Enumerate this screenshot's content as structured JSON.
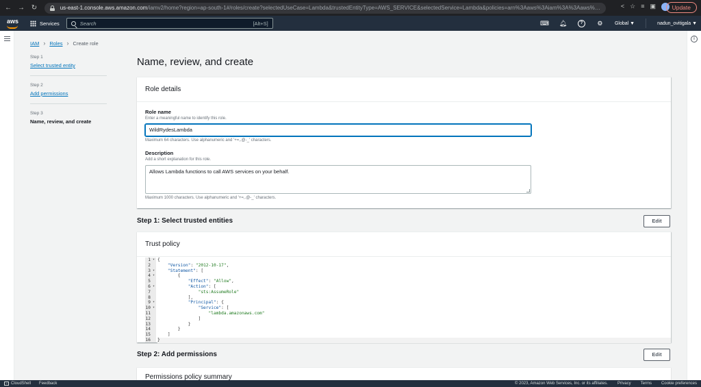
{
  "browser": {
    "url_host": "us-east-1.console.aws.amazon.com",
    "url_path": "/iamv2/home?region=ap-south-1#/roles/create?selectedUseCase=Lambda&trustedEntityType=AWS_SERVICE&selectedService=Lambda&policies=arn%3Aaws%3Aiam%3A%3Aaws%3Apolicy...",
    "update_label": "Update"
  },
  "aws_nav": {
    "logo": "aws",
    "services_label": "Services",
    "search_placeholder": "Search",
    "search_shortcut": "[Alt+S]",
    "region_label": "Global ▼",
    "user_label": "nadun_ovitigala ▼"
  },
  "breadcrumb": {
    "iam": "IAM",
    "roles": "Roles",
    "current": "Create role"
  },
  "steps": [
    {
      "num": "Step 1",
      "label": "Select trusted entity"
    },
    {
      "num": "Step 2",
      "label": "Add permissions"
    },
    {
      "num": "Step 3",
      "label": "Name, review, and create"
    }
  ],
  "page_title": "Name, review, and create",
  "role_details": {
    "header": "Role details",
    "role_name_label": "Role name",
    "role_name_desc": "Enter a meaningful name to identify this role.",
    "role_name_value": "WildRydesLambda",
    "role_name_hint": "Maximum 64 characters. Use alphanumeric and '+=,.@-_' characters.",
    "description_label": "Description",
    "description_desc": "Add a short explanation for this role.",
    "description_value": "Allows Lambda functions to call AWS services on your behalf.",
    "description_hint": "Maximum 1000 characters. Use alphanumeric and '+=,.@-_' characters."
  },
  "step1": {
    "title": "Step 1: Select trusted entities",
    "edit_label": "Edit",
    "trust_policy_header": "Trust policy",
    "code_lines": [
      "{",
      "    \"Version\": \"2012-10-17\",",
      "    \"Statement\": [",
      "        {",
      "            \"Effect\": \"Allow\",",
      "            \"Action\": [",
      "                \"sts:AssumeRole\"",
      "            ],",
      "            \"Principal\": {",
      "                \"Service\": [",
      "                    \"lambda.amazonaws.com\"",
      "                ]",
      "            }",
      "        }",
      "    ]",
      "}"
    ],
    "line_numbers": [
      "1",
      "2",
      "3",
      "4",
      "5",
      "6",
      "7",
      "8",
      "9",
      "10",
      "11",
      "12",
      "13",
      "14",
      "15",
      "16"
    ]
  },
  "step2": {
    "title": "Step 2: Add permissions",
    "edit_label": "Edit",
    "panel_header": "Permissions policy summary"
  },
  "footer": {
    "cloudshell": "CloudShell",
    "feedback": "Feedback",
    "copyright": "© 2023, Amazon Web Services, Inc. or its affiliates.",
    "privacy": "Privacy",
    "terms": "Terms",
    "cookies": "Cookie preferences"
  }
}
